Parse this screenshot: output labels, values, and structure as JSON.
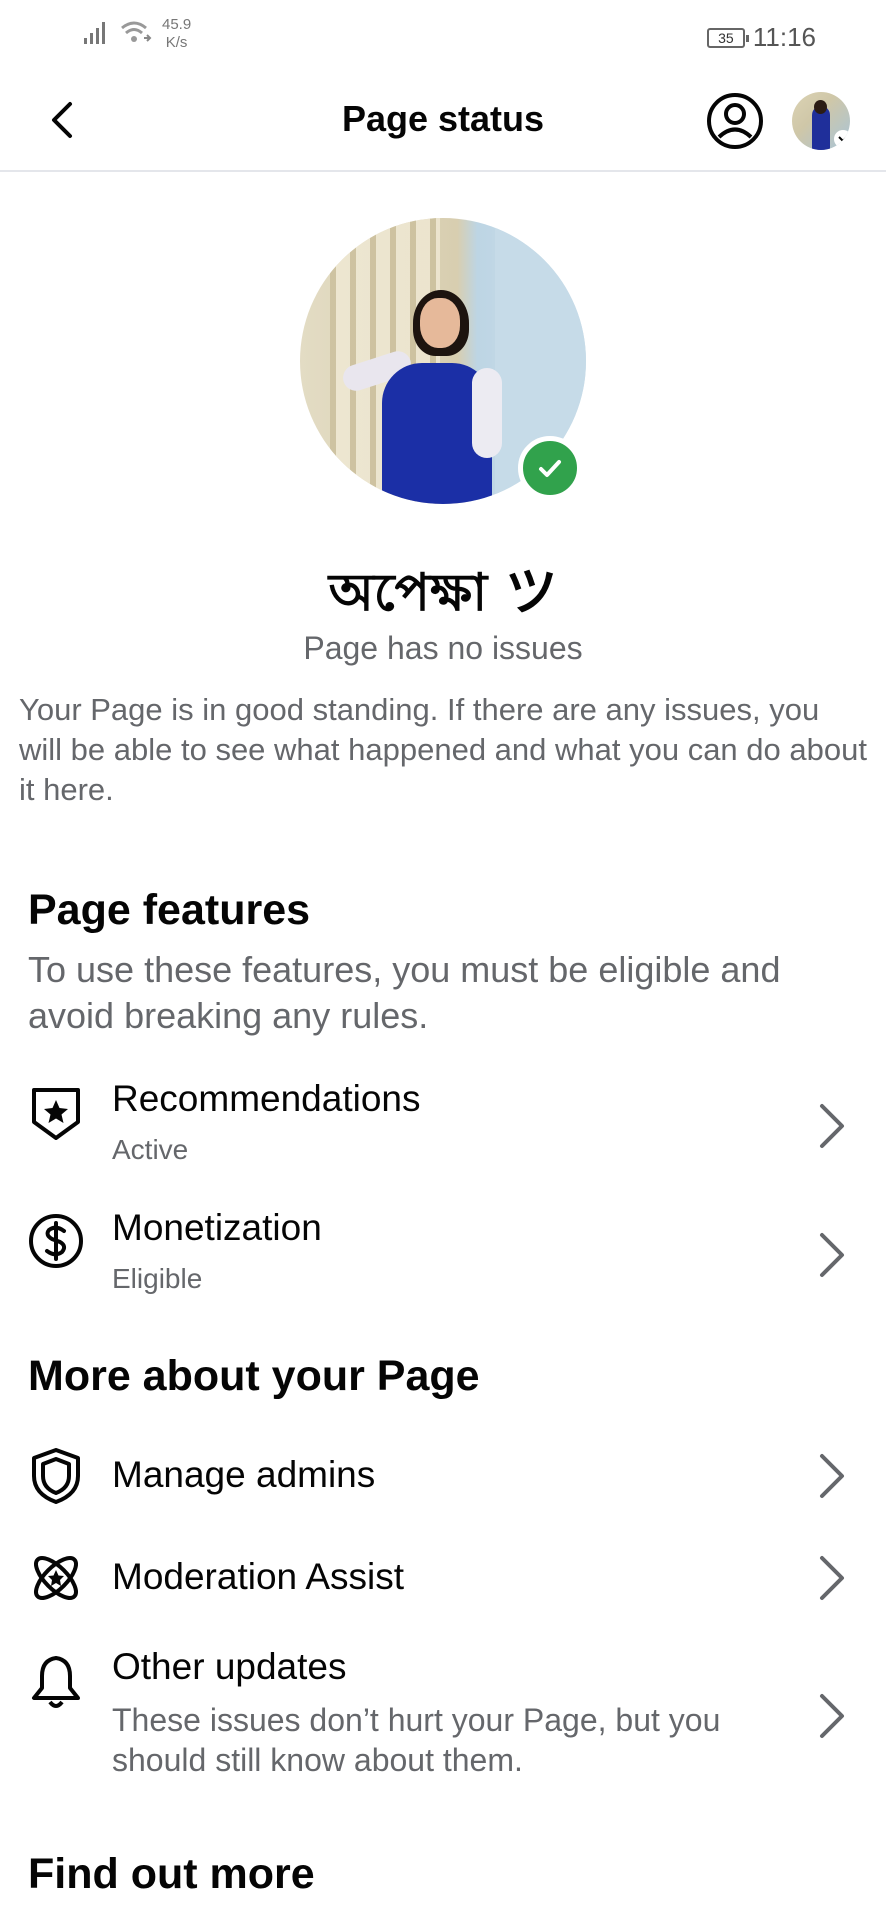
{
  "status_bar": {
    "net_speed_value": "45.9",
    "net_speed_unit": "K/s",
    "battery": "35",
    "time": "11:16",
    "icons": [
      "signal-icon",
      "wifi-icon",
      "battery-icon"
    ]
  },
  "header": {
    "title": "Page status",
    "icons": [
      "back-arrow-icon",
      "account-circle-icon",
      "profile-avatar"
    ]
  },
  "profile": {
    "name": "অপেক্ষা ツ",
    "status": "Page has no issues",
    "description": "Your Page is in good standing. If there are any issues, you will be able to see what happened and what you can do about it here."
  },
  "page_features": {
    "title": "Page features",
    "subtitle": "To use these features, you must be eligible and avoid breaking any rules.",
    "items": [
      {
        "label": "Recommendations",
        "status": "Active",
        "icon": "star-shield-icon"
      },
      {
        "label": "Monetization",
        "status": "Eligible",
        "icon": "dollar-circle-icon"
      }
    ]
  },
  "more_about": {
    "title": "More about your Page",
    "items": [
      {
        "label": "Manage admins",
        "icon": "shield-icon"
      },
      {
        "label": "Moderation Assist",
        "icon": "atom-star-icon"
      },
      {
        "label": "Other updates",
        "description": "These issues don’t hurt your Page, but you should still know about them.",
        "icon": "bell-icon"
      }
    ]
  },
  "find_out_more": {
    "title": "Find out more"
  },
  "colors": {
    "verified_green": "#31a24c",
    "secondary_text": "#65676b",
    "primary_text": "#050505",
    "divider": "#e4e6eb"
  }
}
